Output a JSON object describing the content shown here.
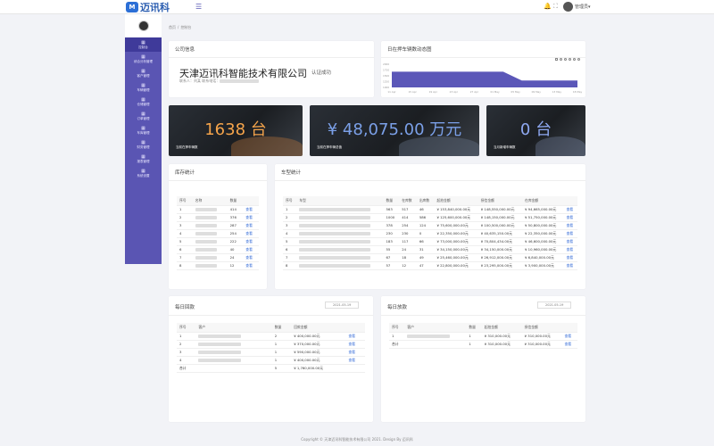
{
  "header": {
    "logo_mark": "M",
    "logo_text": "迈讯科",
    "menu_icon": "menu-icon",
    "user_name": "管理员▾"
  },
  "sidebar": {
    "items": [
      {
        "icon": "▦",
        "label": "控制台"
      },
      {
        "icon": "▦",
        "label": "综合分析管理"
      },
      {
        "icon": "▦",
        "label": "客户管理"
      },
      {
        "icon": "▦",
        "label": "车辆管理"
      },
      {
        "icon": "▦",
        "label": "仓储管理"
      },
      {
        "icon": "▦",
        "label": "订单管理"
      },
      {
        "icon": "▦",
        "label": "车库管理"
      },
      {
        "icon": "▦",
        "label": "财务管理"
      },
      {
        "icon": "▦",
        "label": "报表管理"
      },
      {
        "icon": "▦",
        "label": "系统设置"
      }
    ]
  },
  "breadcrumb": {
    "home": "首页",
    "current": "控制台"
  },
  "company": {
    "title": "公司信息",
    "name": "天津迈讯科智能技术有限公司",
    "status": "认证成功",
    "contact_prefix": "联系人：刘某 联系电话："
  },
  "trend": {
    "title": "日在押车辆数动态图",
    "y_ticks": [
      "2000",
      "1750",
      "1500",
      "1250",
      "1000"
    ],
    "x_ticks": [
      "11 Apr",
      "15 Apr",
      "19 Apr",
      "23 Apr",
      "27 Apr",
      "01 May",
      "05 May",
      "09 May",
      "13 May",
      "18 May"
    ],
    "values": [
      1680,
      1680,
      1680,
      1680,
      1680,
      1680,
      1680,
      1300,
      1300,
      1300,
      1300
    ],
    "ylim": [
      1000,
      2000
    ],
    "tool_icons": [
      "camera-icon",
      "zoom-in-icon",
      "zoom-out-icon",
      "pan-icon",
      "home-icon",
      "download-icon"
    ]
  },
  "stats": [
    {
      "value": "1638 台",
      "label": "当前在押车辆数",
      "color": "#f5a44b"
    },
    {
      "value": "¥ 48,075.00 万元",
      "label": "当前在押车辆总值",
      "color": "#7ba0e8"
    },
    {
      "value": "0 台",
      "label": "当月新增车辆数",
      "color": "#8fa9f2"
    }
  ],
  "stock": {
    "title": "库存统计",
    "headers": [
      "序号",
      "名称",
      "数量",
      ""
    ],
    "rows": [
      [
        "1",
        "",
        "414",
        "查看"
      ],
      [
        "2",
        "",
        "376",
        "查看"
      ],
      [
        "3",
        "",
        "287",
        "查看"
      ],
      [
        "4",
        "",
        "254",
        "查看"
      ],
      [
        "5",
        "",
        "222",
        "查看"
      ],
      [
        "6",
        "",
        "40",
        "查看"
      ],
      [
        "7",
        "",
        "24",
        "查看"
      ],
      [
        "8",
        "",
        "12",
        "查看"
      ]
    ]
  },
  "models": {
    "title": "车型统计",
    "headers": [
      "序号",
      "车型",
      "数量",
      "在库数",
      "出库数",
      "起拍金额",
      "授信金额",
      "在库金额",
      ""
    ],
    "rows": [
      [
        "1",
        "",
        "563",
        "517",
        "46",
        "¥ 153,840,000.00元",
        "¥ 148,550,000.00元",
        "¥ 94,665,000.00元",
        "查看"
      ],
      [
        "2",
        "",
        "1000",
        "414",
        "586",
        "¥ 125,600,000.00元",
        "¥ 148,150,000.00元",
        "¥ 51,750,000.00元",
        "查看"
      ],
      [
        "3",
        "",
        "378",
        "254",
        "124",
        "¥ 75,600,000.00元",
        "¥ 100,500,000.00元",
        "¥ 50,800,000.00元",
        "查看"
      ],
      [
        "4",
        "",
        "230",
        "230",
        "0",
        "¥ 22,350,000.00元",
        "¥ 40,635,150.00元",
        "¥ 22,350,000.00元",
        "查看"
      ],
      [
        "5",
        "",
        "183",
        "117",
        "66",
        "¥ 73,000,000.00元",
        "¥ 70,804,434.00元",
        "¥ 46,600,000.00元",
        "查看"
      ],
      [
        "6",
        "",
        "55",
        "24",
        "31",
        "¥ 34,150,000.00元",
        "¥ 34,150,000.00元",
        "¥ 10,960,000.00元",
        "查看"
      ],
      [
        "7",
        "",
        "67",
        "18",
        "49",
        "¥ 25,460,000.00元",
        "¥ 26,912,000.00元",
        "¥ 6,840,000.00元",
        "查看"
      ],
      [
        "8",
        "",
        "57",
        "12",
        "47",
        "¥ 22,800,000.00元",
        "¥ 23,295,000.00元",
        "¥ 3,900,000.00元",
        "查看"
      ]
    ]
  },
  "daily_payment": {
    "title": "每日回款",
    "date": "2021-05-19",
    "headers": [
      "序号",
      "客户",
      "数量",
      "回款金额",
      ""
    ],
    "rows": [
      [
        "1",
        "",
        "2",
        "¥ 400,000.00元",
        "查看"
      ],
      [
        "2",
        "",
        "1",
        "¥ 370,000.00元",
        "查看"
      ],
      [
        "3",
        "",
        "1",
        "¥ 590,000.00元",
        "查看"
      ],
      [
        "4",
        "",
        "1",
        "¥ 400,000.00元",
        "查看"
      ],
      [
        "合计",
        "",
        "5",
        "¥ 1,760,000.00元",
        ""
      ]
    ]
  },
  "daily_loan": {
    "title": "每日放款",
    "date": "2021-05-19",
    "headers": [
      "序号",
      "客户",
      "数量",
      "起拍金额",
      "授信金额",
      ""
    ],
    "rows": [
      [
        "1",
        "",
        "1",
        "¥ 310,000.00元",
        "¥ 310,000.00元",
        "查看"
      ],
      [
        "合计",
        "",
        "1",
        "¥ 310,000.00元",
        "¥ 310,000.00元",
        "查看"
      ]
    ]
  },
  "footer": "Copyright © 天津迈讯科智能技术有限公司 2021. Design By 迈讯科"
}
